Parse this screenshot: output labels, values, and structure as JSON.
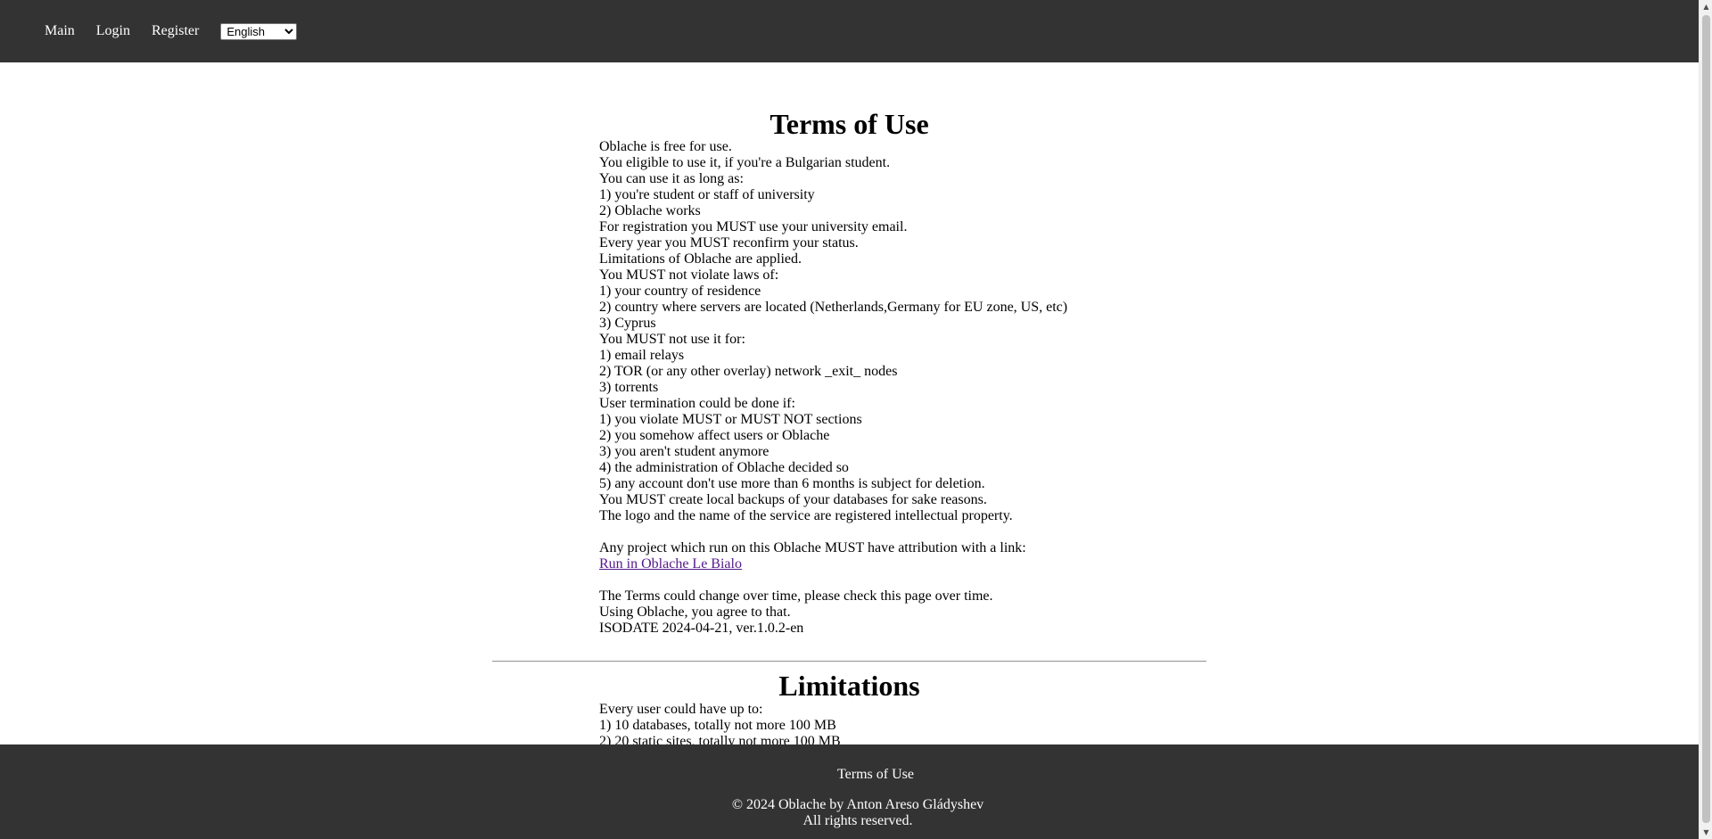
{
  "nav": {
    "main": "Main",
    "login": "Login",
    "register": "Register",
    "language": {
      "selected": "English",
      "options": [
        "English"
      ]
    }
  },
  "terms": {
    "title": "Terms of Use",
    "lines": [
      "Oblache is free for use.",
      "You eligible to use it, if you're a Bulgarian student.",
      "You can use it as long as:",
      "1) you're student or staff of university",
      "2) Oblache works",
      "For registration you MUST use your university email.",
      "Every year you MUST reconfirm your status.",
      "Limitations of Oblache are applied.",
      "You MUST not violate laws of:",
      "1) your country of residence",
      "2) country where servers are located (Netherlands,Germany for EU zone, US, etc)",
      "3) Cyprus",
      "You MUST not use it for:",
      "1) email relays",
      "2) TOR (or any other overlay) network _exit_ nodes",
      "3) torrents",
      "User termination could be done if:",
      "1) you violate MUST or MUST NOT sections",
      "2) you somehow affect users or Oblache",
      "3) you aren't student anymore",
      "4) the administration of Oblache decided so",
      "5) any account don't use more than 6 months is subject for deletion.",
      "You MUST create local backups of your databases for sake reasons.",
      "The logo and the name of the service are registered intellectual property."
    ],
    "attribution_text": "Any project which run on this Oblache MUST have attribution with a link:",
    "attribution_link": "Run in Oblache Le Bialo",
    "closing_lines": [
      "The Terms could change over time, please check this page over time.",
      "Using Oblache, you agree to that.",
      "ISODATE 2024-04-21, ver.1.0.2-en"
    ]
  },
  "limitations": {
    "title": "Limitations",
    "lines": [
      "Every user could have up to:",
      "1) 10 databases, totally not more 100 MB",
      "2) 20 static sites, totally not more 100 MB"
    ]
  },
  "footer": {
    "terms_link": "Terms of Use",
    "copyright": "© 2024 Oblache by Anton Areso Gládyshev",
    "rights": "All rights reserved."
  }
}
